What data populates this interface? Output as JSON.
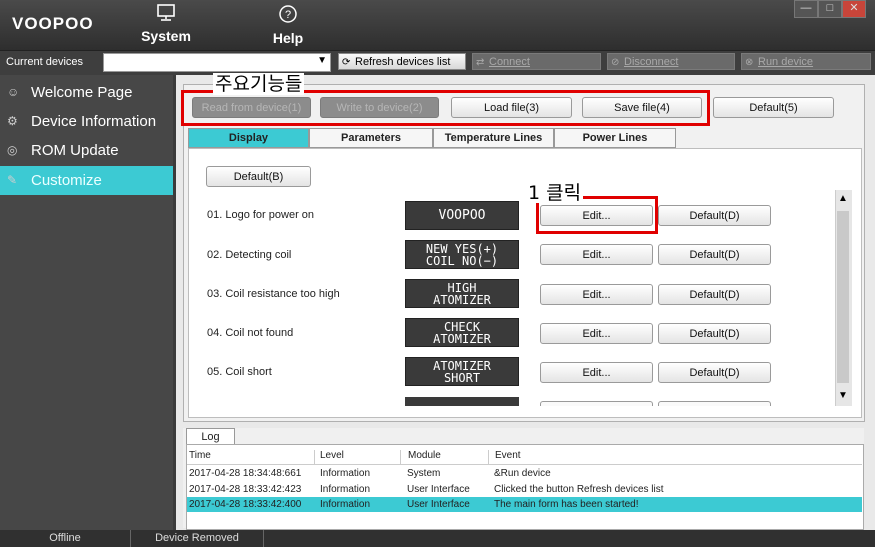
{
  "app": {
    "logo": "VOOPOO"
  },
  "menu": {
    "system": {
      "label": "System",
      "icon": "monitor-icon"
    },
    "help": {
      "label": "Help",
      "icon": "help-circle-icon"
    }
  },
  "window_controls": {
    "minimize": "—",
    "maximize": "□",
    "close": "✕"
  },
  "devices": {
    "label": "Current devices",
    "selected": "",
    "refresh": "Refresh devices list",
    "connect": "Connect",
    "disconnect": "Disconnect",
    "run": "Run device"
  },
  "sidebar": {
    "items": [
      {
        "label": "Welcome Page",
        "icon": "smiley-icon",
        "active": false
      },
      {
        "label": "Device Information",
        "icon": "gear-icon",
        "active": false
      },
      {
        "label": "ROM Update",
        "icon": "disc-icon",
        "active": false
      },
      {
        "label": "Customize",
        "icon": "pen-icon",
        "active": true
      }
    ]
  },
  "annotations": {
    "main_functions": "주요기능들",
    "click_step": "1 클릭"
  },
  "toolbar": {
    "read": "Read from device(1)",
    "write": "Write to device(2)",
    "load": "Load file(3)",
    "save": "Save file(4)",
    "default": "Default(5)"
  },
  "tabs": [
    "Display",
    "Parameters",
    "Temperature Lines",
    "Power Lines"
  ],
  "display": {
    "default_button": "Default(B)",
    "edit_label": "Edit...",
    "default_label": "Default(D)",
    "rows": [
      {
        "label": "01. Logo for power on",
        "lcd1": "VOOPOO",
        "lcd2": ""
      },
      {
        "label": "02. Detecting coil",
        "lcd1": "NEW  YES(+)",
        "lcd2": "COIL  NO(−)"
      },
      {
        "label": "03. Coil resistance too high",
        "lcd1": "HIGH",
        "lcd2": "ATOMIZER"
      },
      {
        "label": "04. Coil not found",
        "lcd1": "CHECK",
        "lcd2": "ATOMIZER"
      },
      {
        "label": "05. Coil short",
        "lcd1": "ATOMIZER",
        "lcd2": "SHORT"
      }
    ]
  },
  "log": {
    "tab": "Log",
    "columns": [
      "Time",
      "Level",
      "Module",
      "Event"
    ],
    "rows": [
      [
        "2017-04-28 18:34:48:661",
        "Information",
        "System",
        "&Run device"
      ],
      [
        "2017-04-28 18:33:42:423",
        "Information",
        "User Interface",
        "Clicked the button Refresh devices list"
      ],
      [
        "2017-04-28 18:33:42:400",
        "Information",
        "User Interface",
        "The main form has been started!"
      ]
    ]
  },
  "status": {
    "connection": "Offline",
    "device": "Device Removed"
  },
  "colors": {
    "accent": "#3ccad3",
    "highlight_box": "#e00000"
  }
}
